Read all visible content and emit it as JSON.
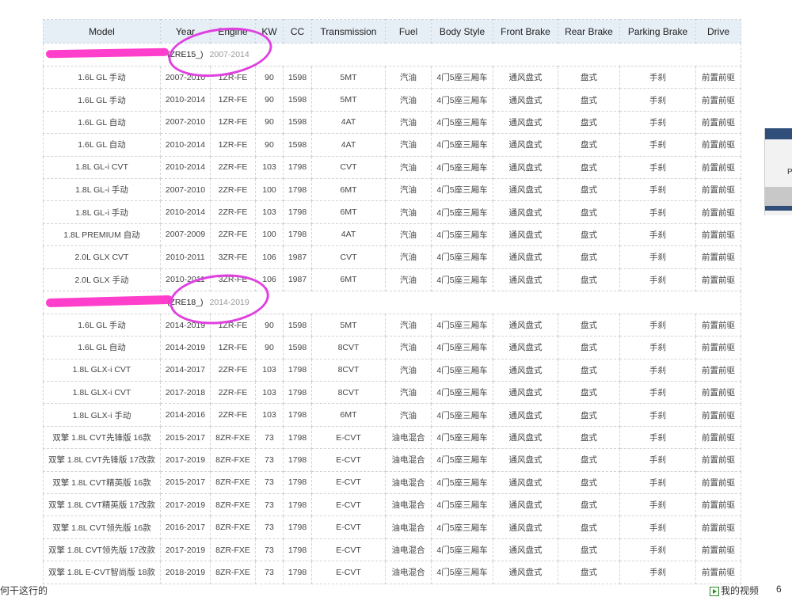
{
  "headers": [
    "Model",
    "Year",
    "Engine",
    "KW",
    "CC",
    "Transmission",
    "Fuel",
    "Body Style",
    "Front Brake",
    "Rear Brake",
    "Parking Brake",
    "Drive"
  ],
  "groups": [
    {
      "model": "(ZRE15_)",
      "years": "2007-2014",
      "rows": [
        [
          "1.6L GL 手动",
          "2007-2010",
          "1ZR-FE",
          "90",
          "1598",
          "5MT",
          "汽油",
          "4门5座三厢车",
          "通风盘式",
          "盘式",
          "手刹",
          "前置前驱"
        ],
        [
          "1.6L GL 手动",
          "2010-2014",
          "1ZR-FE",
          "90",
          "1598",
          "5MT",
          "汽油",
          "4门5座三厢车",
          "通风盘式",
          "盘式",
          "手刹",
          "前置前驱"
        ],
        [
          "1.6L GL 自动",
          "2007-2010",
          "1ZR-FE",
          "90",
          "1598",
          "4AT",
          "汽油",
          "4门5座三厢车",
          "通风盘式",
          "盘式",
          "手刹",
          "前置前驱"
        ],
        [
          "1.6L GL 自动",
          "2010-2014",
          "1ZR-FE",
          "90",
          "1598",
          "4AT",
          "汽油",
          "4门5座三厢车",
          "通风盘式",
          "盘式",
          "手刹",
          "前置前驱"
        ],
        [
          "1.8L GL-i CVT",
          "2010-2014",
          "2ZR-FE",
          "103",
          "1798",
          "CVT",
          "汽油",
          "4门5座三厢车",
          "通风盘式",
          "盘式",
          "手刹",
          "前置前驱"
        ],
        [
          "1.8L GL-i 手动",
          "2007-2010",
          "2ZR-FE",
          "100",
          "1798",
          "6MT",
          "汽油",
          "4门5座三厢车",
          "通风盘式",
          "盘式",
          "手刹",
          "前置前驱"
        ],
        [
          "1.8L GL-i 手动",
          "2010-2014",
          "2ZR-FE",
          "103",
          "1798",
          "6MT",
          "汽油",
          "4门5座三厢车",
          "通风盘式",
          "盘式",
          "手刹",
          "前置前驱"
        ],
        [
          "1.8L PREMIUM 自动",
          "2007-2009",
          "2ZR-FE",
          "100",
          "1798",
          "4AT",
          "汽油",
          "4门5座三厢车",
          "通风盘式",
          "盘式",
          "手刹",
          "前置前驱"
        ],
        [
          "2.0L GLX CVT",
          "2010-2011",
          "3ZR-FE",
          "106",
          "1987",
          "CVT",
          "汽油",
          "4门5座三厢车",
          "通风盘式",
          "盘式",
          "手刹",
          "前置前驱"
        ],
        [
          "2.0L GLX 手动",
          "2010-2011",
          "3ZR-FE",
          "106",
          "1987",
          "6MT",
          "汽油",
          "4门5座三厢车",
          "通风盘式",
          "盘式",
          "手刹",
          "前置前驱"
        ]
      ]
    },
    {
      "model": "(ZRE18_)",
      "years": "2014-2019",
      "rows": [
        [
          "1.6L GL 手动",
          "2014-2019",
          "1ZR-FE",
          "90",
          "1598",
          "5MT",
          "汽油",
          "4门5座三厢车",
          "通风盘式",
          "盘式",
          "手刹",
          "前置前驱"
        ],
        [
          "1.6L GL 自动",
          "2014-2019",
          "1ZR-FE",
          "90",
          "1598",
          "8CVT",
          "汽油",
          "4门5座三厢车",
          "通风盘式",
          "盘式",
          "手刹",
          "前置前驱"
        ],
        [
          "1.8L GLX-i CVT",
          "2014-2017",
          "2ZR-FE",
          "103",
          "1798",
          "8CVT",
          "汽油",
          "4门5座三厢车",
          "通风盘式",
          "盘式",
          "手刹",
          "前置前驱"
        ],
        [
          "1.8L GLX-i CVT",
          "2017-2018",
          "2ZR-FE",
          "103",
          "1798",
          "8CVT",
          "汽油",
          "4门5座三厢车",
          "通风盘式",
          "盘式",
          "手刹",
          "前置前驱"
        ],
        [
          "1.8L GLX-i 手动",
          "2014-2016",
          "2ZR-FE",
          "103",
          "1798",
          "6MT",
          "汽油",
          "4门5座三厢车",
          "通风盘式",
          "盘式",
          "手刹",
          "前置前驱"
        ],
        [
          "双擎 1.8L CVT先锋版 16款",
          "2015-2017",
          "8ZR-FXE",
          "73",
          "1798",
          "E-CVT",
          "油电混合",
          "4门5座三厢车",
          "通风盘式",
          "盘式",
          "手刹",
          "前置前驱"
        ],
        [
          "双擎 1.8L CVT先锋版 17改款",
          "2017-2019",
          "8ZR-FXE",
          "73",
          "1798",
          "E-CVT",
          "油电混合",
          "4门5座三厢车",
          "通风盘式",
          "盘式",
          "手刹",
          "前置前驱"
        ],
        [
          "双擎 1.8L CVT精英版 16款",
          "2015-2017",
          "8ZR-FXE",
          "73",
          "1798",
          "E-CVT",
          "油电混合",
          "4门5座三厢车",
          "通风盘式",
          "盘式",
          "手刹",
          "前置前驱"
        ],
        [
          "双擎 1.8L CVT精英版 17改款",
          "2017-2019",
          "8ZR-FXE",
          "73",
          "1798",
          "E-CVT",
          "油电混合",
          "4门5座三厢车",
          "通风盘式",
          "盘式",
          "手刹",
          "前置前驱"
        ],
        [
          "双擎 1.8L CVT领先版 16款",
          "2016-2017",
          "8ZR-FXE",
          "73",
          "1798",
          "E-CVT",
          "油电混合",
          "4门5座三厢车",
          "通风盘式",
          "盘式",
          "手刹",
          "前置前驱"
        ],
        [
          "双擎 1.8L CVT领先版 17改款",
          "2017-2019",
          "8ZR-FXE",
          "73",
          "1798",
          "E-CVT",
          "油电混合",
          "4门5座三厢车",
          "通风盘式",
          "盘式",
          "手刹",
          "前置前驱"
        ],
        [
          "双擎 1.8L E-CVT智尚版 18款",
          "2018-2019",
          "8ZR-FXE",
          "73",
          "1798",
          "E-CVT",
          "油电混合",
          "4门5座三厢车",
          "通风盘式",
          "盘式",
          "手刹",
          "前置前驱"
        ]
      ]
    }
  ],
  "footer": {
    "left_text": "何干这行的",
    "right_text": "我的视频",
    "right_num": "6"
  },
  "side_panel": {
    "letter": "P"
  },
  "colors": {
    "header_bg": "#e6eef6",
    "marker": "#e040e0",
    "redact": "#ff2ec8"
  }
}
